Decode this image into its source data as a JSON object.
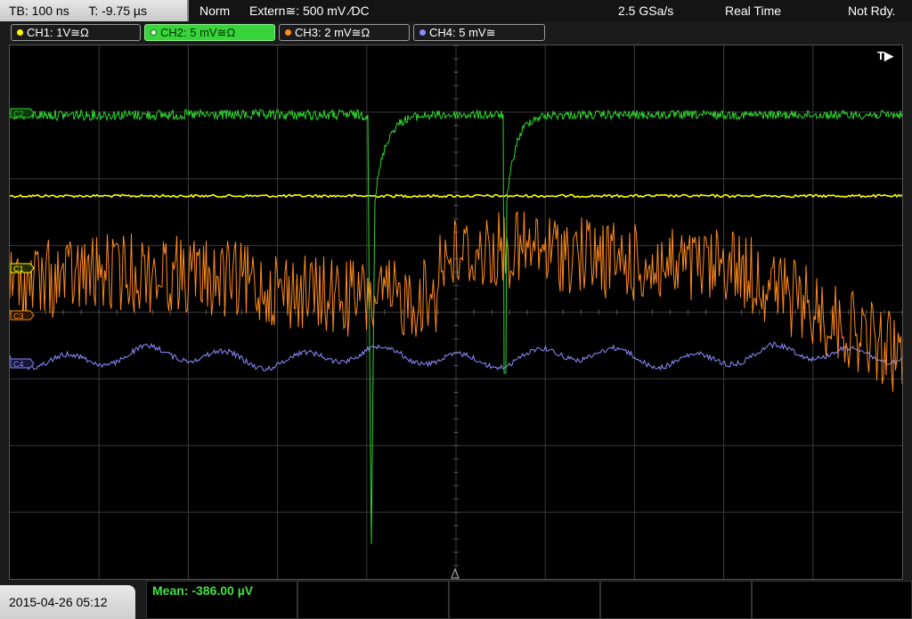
{
  "status_bar": {
    "timebase": "TB: 100 ns",
    "trigger_time": "T: -9.75 µs",
    "trigger_mode": "Norm",
    "trigger_source": "Extern≅: 500 mV ⁄DC",
    "sample_rate": "2.5 GSa/s",
    "acq_mode": "Real Time",
    "trigger_status": "Not Rdy."
  },
  "channels": [
    {
      "label": "CH1: 1V≅Ω",
      "color": "#ffff00",
      "active": false
    },
    {
      "label": "CH2: 5 mV≅Ω",
      "color": "#39d33b",
      "active": true
    },
    {
      "label": "CH3: 2 mV≅Ω",
      "color": "#ff8c1a",
      "active": false
    },
    {
      "label": "CH4: 5 mV≅",
      "color": "#8a8aff",
      "active": false
    }
  ],
  "markers": {
    "ch1": "C1",
    "ch2": "C2",
    "ch3": "C3",
    "ch4": "C4",
    "trigger": "T▶"
  },
  "measurement": {
    "mean": "Mean: -386.00 µV"
  },
  "datetime": "2015-04-26 05:12",
  "colors": {
    "ch1": "#ffff00",
    "ch2": "#2fd42f",
    "ch3": "#ff8a1a",
    "ch4": "#8c8cff",
    "grid": "#3a3a3a"
  }
}
